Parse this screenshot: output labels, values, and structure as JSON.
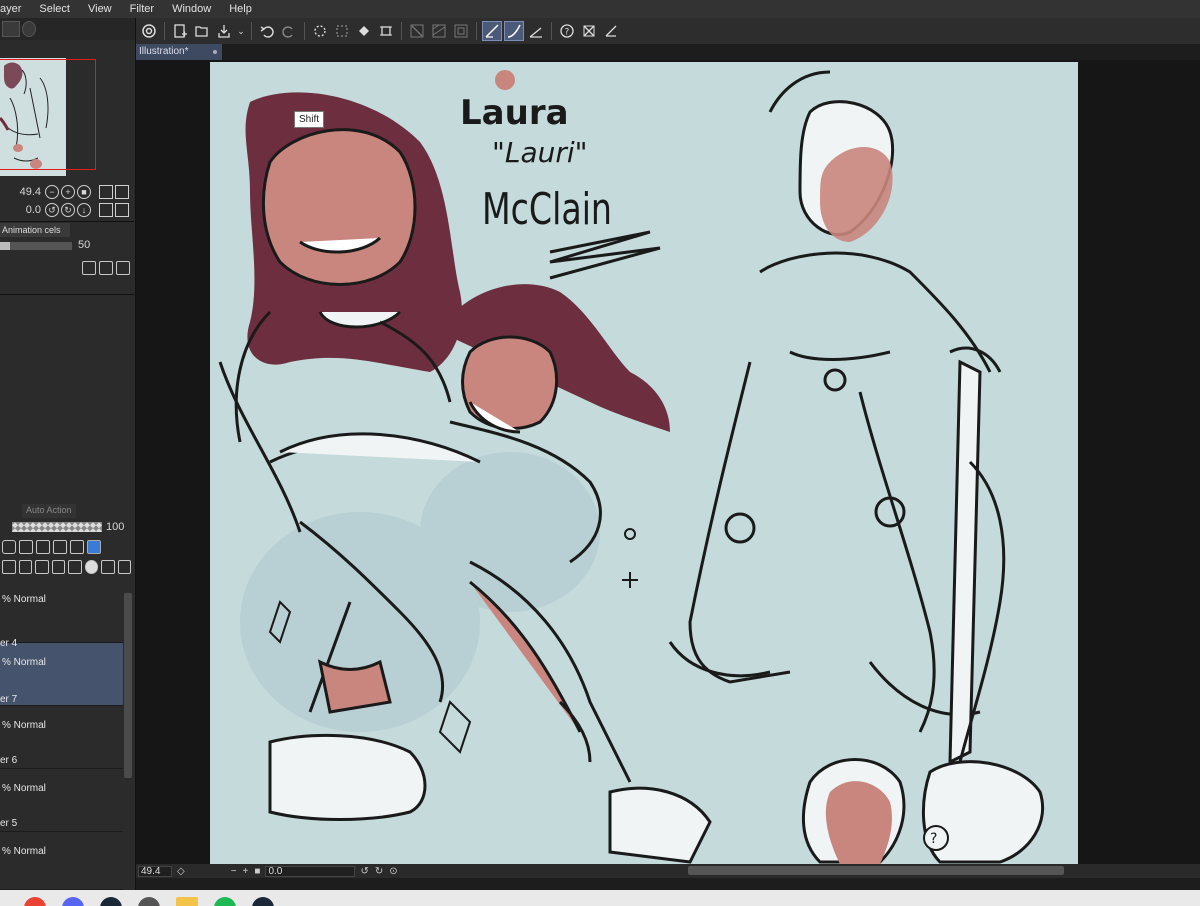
{
  "menu": [
    "ayer",
    "Select",
    "View",
    "Filter",
    "Window",
    "Help"
  ],
  "toolbar": {
    "icons": [
      "app-logo-icon",
      "new-file-icon",
      "open-file-icon",
      "save-icon",
      "undo-icon",
      "redo-icon",
      "loading-icon",
      "grid-icon",
      "fill-icon",
      "transform-icon",
      "ruler-icon",
      "snap-icon",
      "pen-pressure-icon",
      "stabilizer-icon",
      "help-icon",
      "settings-icon"
    ]
  },
  "navigator": {
    "zoom": "49.4",
    "rotation": "0.0"
  },
  "animation": {
    "tab_label": "Animation cels",
    "opacity": "50"
  },
  "layers_panel": {
    "auto_action_tab": "Auto Action",
    "opacity": "100",
    "layers": [
      {
        "mode": "% Normal",
        "name": ""
      },
      {
        "mode": "% Normal",
        "name": "er 4",
        "selected": true
      },
      {
        "mode": "% Normal",
        "name": "er 7"
      },
      {
        "mode": "% Normal",
        "name": "er 6"
      },
      {
        "mode": "% Normal",
        "name": "er 5"
      }
    ]
  },
  "document": {
    "tab_title": "Illustration*"
  },
  "canvas": {
    "tooltip": "Shift",
    "lettering": [
      "Laura",
      "\"Lauri\"",
      "McClain"
    ]
  },
  "statusbar": {
    "zoom": "49.4",
    "rotation": "0.0"
  },
  "colors": {
    "canvas_bg": "#c4dadb",
    "hair": "#6d2f3f",
    "skin": "#c9867e",
    "line": "#1a1a1a",
    "selection": "#46536d"
  }
}
